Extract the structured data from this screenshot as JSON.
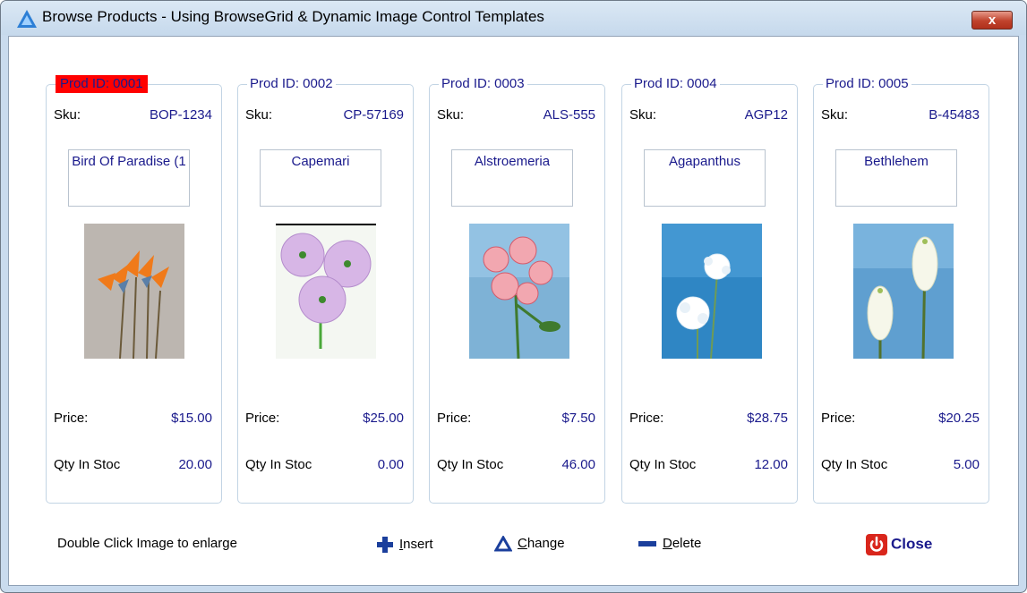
{
  "window": {
    "title": "Browse Products  -  Using BrowseGrid & Dynamic Image Control Templates",
    "close_glyph": "x"
  },
  "cards": [
    {
      "prod_id": "Prod ID: 0001",
      "sku_label": "Sku:",
      "sku": "BOP-1234",
      "name": "Bird Of Paradise (1",
      "price_label": "Price:",
      "price": "$15.00",
      "qty_label": "Qty In Stoc",
      "qty": "20.00",
      "selected": true,
      "image": "bird-of-paradise-flower-image"
    },
    {
      "prod_id": "Prod ID: 0002",
      "sku_label": "Sku:",
      "sku": "CP-57169",
      "name": "Capemari",
      "price_label": "Price:",
      "price": "$25.00",
      "qty_label": "Qty In Stoc",
      "qty": "0.00",
      "selected": false,
      "image": "capemari-flower-image"
    },
    {
      "prod_id": "Prod ID: 0003",
      "sku_label": "Sku:",
      "sku": "ALS-555",
      "name": "Alstroemeria",
      "price_label": "Price:",
      "price": "$7.50",
      "qty_label": "Qty In Stoc",
      "qty": "46.00",
      "selected": false,
      "image": "alstroemeria-flower-image"
    },
    {
      "prod_id": "Prod ID: 0004",
      "sku_label": "Sku:",
      "sku": "AGP12",
      "name": "Agapanthus",
      "price_label": "Price:",
      "price": "$28.75",
      "qty_label": "Qty In Stoc",
      "qty": "12.00",
      "selected": false,
      "image": "agapanthus-flower-image"
    },
    {
      "prod_id": "Prod ID: 0005",
      "sku_label": "Sku:",
      "sku": "B-45483",
      "name": "Bethlehem",
      "price_label": "Price:",
      "price": "$20.25",
      "qty_label": "Qty In Stoc",
      "qty": "5.00",
      "selected": false,
      "image": "bethlehem-flower-image"
    }
  ],
  "footer": {
    "hint": "Double Click Image to enlarge",
    "insert_underlined": "I",
    "insert_rest": "nsert",
    "change_underlined": "C",
    "change_rest": "hange",
    "delete_underlined": "D",
    "delete_rest": "elete",
    "close_label": "Close"
  },
  "colors": {
    "accent_text": "#1a1a8c",
    "selected_highlight": "#ff0000",
    "frame": "#c9dbee"
  }
}
